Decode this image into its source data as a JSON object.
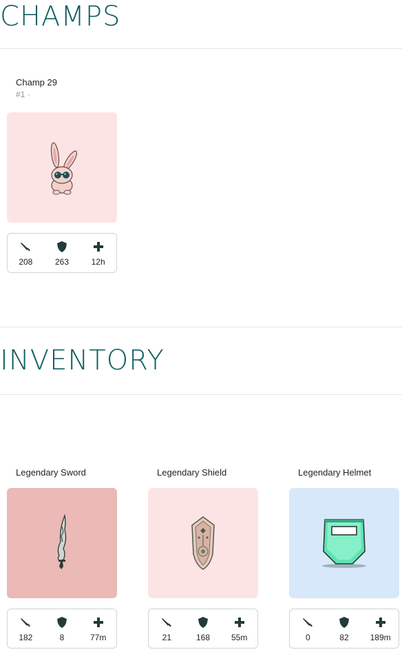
{
  "sections": {
    "champs_title": "CHAMPS",
    "inventory_title": "INVENTORY"
  },
  "champ": {
    "name": "Champ 29",
    "rank": "#1 ·",
    "art_bg": "#fde4e4",
    "art_icon": "rabbit-icon",
    "stats": {
      "attack": "208",
      "defense": "263",
      "health": "12h"
    }
  },
  "inventory": [
    {
      "name": "Legendary Sword",
      "art_bg": "#ebb9b6",
      "art_icon": "sword-icon",
      "stats": {
        "attack": "182",
        "defense": "8",
        "health": "77m"
      }
    },
    {
      "name": "Legendary Shield",
      "art_bg": "#fde4e4",
      "art_icon": "shield-item-icon",
      "stats": {
        "attack": "21",
        "defense": "168",
        "health": "55m"
      }
    },
    {
      "name": "Legendary Helmet",
      "art_bg": "#d7e8fb",
      "art_icon": "helmet-icon",
      "stats": {
        "attack": "0",
        "defense": "82",
        "health": "189m"
      }
    }
  ],
  "colors": {
    "accent": "#0f5e63",
    "stat_icon": "#243a3a"
  }
}
